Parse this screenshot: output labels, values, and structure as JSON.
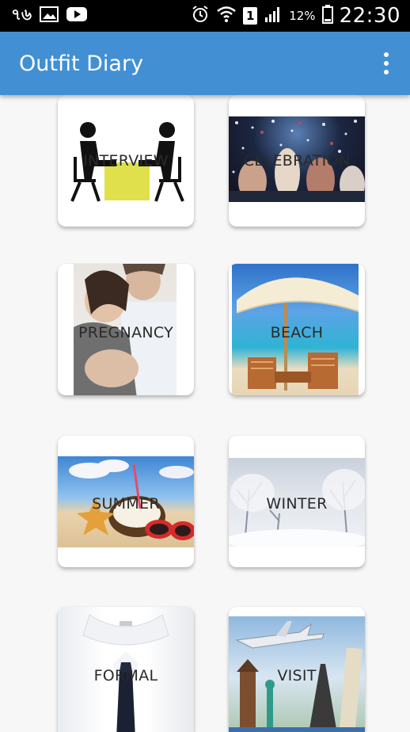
{
  "status_bar": {
    "carrier": "৭৬",
    "battery_percent": "12%",
    "time": "22:30",
    "sim_slot": "1",
    "icons": [
      "image-icon",
      "youtube-icon",
      "alarm-icon",
      "wifi-icon",
      "signal-icon",
      "battery-icon"
    ]
  },
  "app_bar": {
    "title": "Outfit Diary",
    "menu_icon": "overflow-menu-icon",
    "color": "#4290d3"
  },
  "categories": [
    {
      "label": "INTERVIEW"
    },
    {
      "label": "CELEBRATION"
    },
    {
      "label": "PREGNANCY"
    },
    {
      "label": "BEACH"
    },
    {
      "label": "SUMMER"
    },
    {
      "label": "WINTER"
    },
    {
      "label": "FORMAL"
    },
    {
      "label": "VISIT"
    }
  ]
}
